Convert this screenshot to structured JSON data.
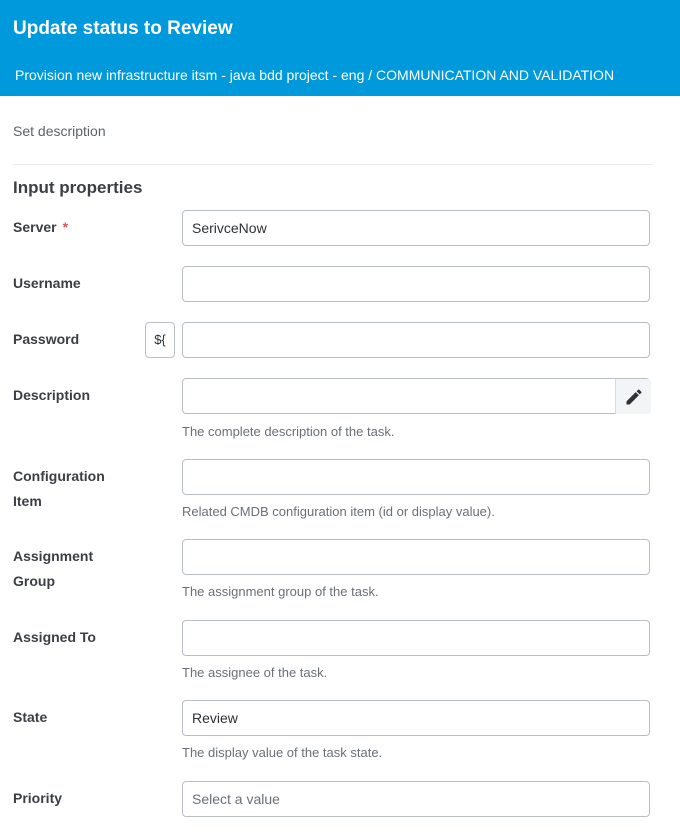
{
  "header": {
    "title": "Update status to Review",
    "subtitle": "Provision new infrastructure itsm - java bdd project - eng / COMMUNICATION AND VALIDATION"
  },
  "set_description": "Set description",
  "section_title": "Input properties",
  "required_mark": "*",
  "fields": {
    "server": {
      "label": "Server",
      "value": "SerivceNow"
    },
    "username": {
      "label": "Username",
      "value": ""
    },
    "password": {
      "label": "Password",
      "value": "",
      "variable_button": "${"
    },
    "description": {
      "label": "Description",
      "value": "",
      "help": "The complete description of the task.",
      "icon": "pencil-icon"
    },
    "configuration_item": {
      "label_line1": "Configuration",
      "label_line2": "Item",
      "value": "",
      "help": "Related CMDB configuration item (id or display value)."
    },
    "assignment_group": {
      "label_line1": "Assignment",
      "label_line2": "Group",
      "value": "",
      "help": "The assignment group of the task."
    },
    "assigned_to": {
      "label": "Assigned To",
      "value": "",
      "help": "The assignee of the task."
    },
    "state": {
      "label": "State",
      "value": "Review",
      "help": "The display value of the task state."
    },
    "priority": {
      "label": "Priority",
      "placeholder": "Select a value"
    }
  },
  "colors": {
    "header_bg": "#0099db",
    "required": "#d9534f"
  }
}
